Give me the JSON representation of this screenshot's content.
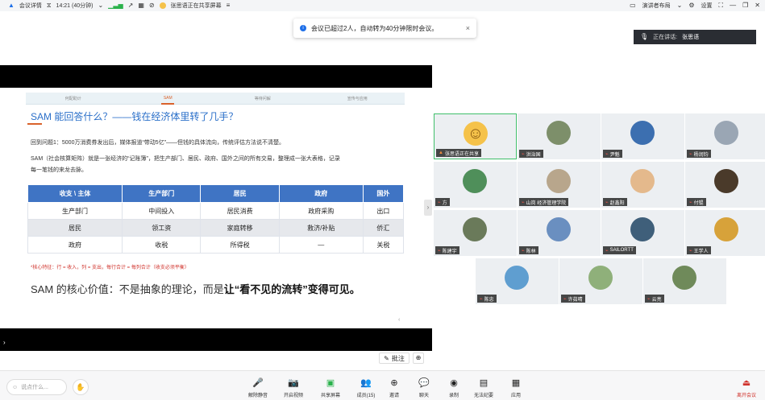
{
  "topbar": {
    "app_icon": "meeting-logo-icon",
    "meeting_details": "会议详情",
    "timer": "14:21 (40分钟)",
    "sharing_status": "张思语正在共享屏幕",
    "presenter_layout": "演讲者布局",
    "settings": "设置"
  },
  "toast": {
    "message": "会议已超过2人，自动转为40分钟限时会议。",
    "close": "×"
  },
  "speaking": {
    "label": "正在讲话:",
    "name": "张思语"
  },
  "slide": {
    "nav": [
      "何配助计",
      "SAM",
      "等待问解",
      "宣传与应用"
    ],
    "title": "SAM 能回答什么？——钱在经济体里转了几手？",
    "para1": "回到问题1：5000万消费券发出后，媒体报道“带动5亿”——但钱的具体流向，传统评估方法说不清楚。",
    "para2a": "SAM（社会核算矩阵）就是一张经济的“记账簿”，把生产部门、居民、政府、国外之间的所有交易，整理成一张大表格，记录",
    "para2b": "每一笔钱的来龙去脉。",
    "table_headers": [
      "收支 \\ 主体",
      "生产部门",
      "居民",
      "政府",
      "国外"
    ],
    "table_rows": [
      [
        "生产部门",
        "中间投入",
        "居民消费",
        "政府采购",
        "出口"
      ],
      [
        "居民",
        "领工资",
        "家庭转移",
        "救济/补贴",
        "侨汇"
      ],
      [
        "政府",
        "收税",
        "所得税",
        "—",
        "关税"
      ]
    ],
    "note": "*核心特征：行 = 收入，列 = 支出，每行合计 = 每列合计（收支必须平衡）",
    "core_prefix": "SAM 的核心价值：不是抽象的理论，而是",
    "core_bold": "让“看不见的流转”变得可见。",
    "page_marker": "‹"
  },
  "share_controls": {
    "annotate": "批注"
  },
  "participants": [
    {
      "name": "张思语正在共享",
      "avatar_color": "#f5c24a",
      "active": true
    },
    {
      "name": "洪治国",
      "avatar_color": "#7d8f6a"
    },
    {
      "name": "尹魁",
      "avatar_color": "#3c6fb0"
    },
    {
      "name": "杨润钧",
      "avatar_color": "#9aa6b4"
    },
    {
      "name": "方",
      "avatar_color": "#4f8f5a"
    },
    {
      "name": "山岗 经济管理学院",
      "avatar_color": "#b8a68c"
    },
    {
      "name": "赵鑫阳",
      "avatar_color": "#e4b98c"
    },
    {
      "name": "付锟",
      "avatar_color": "#4a3a2a"
    },
    {
      "name": "陈建宇",
      "avatar_color": "#6a7a5a"
    },
    {
      "name": "陈林",
      "avatar_color": "#6a8fc0"
    },
    {
      "name": "SAILORTT",
      "avatar_color": "#3f5f7a"
    },
    {
      "name": "王学人",
      "avatar_color": "#d7a23a"
    },
    {
      "name": "陈忠",
      "avatar_color": "#5f9ed0"
    },
    {
      "name": "许茹晴",
      "avatar_color": "#8fb07a"
    },
    {
      "name": "云亮",
      "avatar_color": "#6f8a5a"
    }
  ],
  "toolbar": {
    "chat_placeholder": "说点什么...",
    "tools": [
      {
        "label": "解除静音",
        "icon": "mic-off-icon"
      },
      {
        "label": "开启视频",
        "icon": "camera-off-icon"
      },
      {
        "label": "共享屏幕",
        "icon": "share-screen-icon"
      },
      {
        "label": "成员(15)",
        "icon": "members-icon"
      },
      {
        "label": "邀请",
        "icon": "invite-icon"
      },
      {
        "label": "聊天",
        "icon": "chat-icon"
      },
      {
        "label": "录制",
        "icon": "record-icon"
      },
      {
        "label": "无法纪要",
        "icon": "minutes-icon"
      },
      {
        "label": "应用",
        "icon": "apps-icon"
      }
    ],
    "leave": "离开会议"
  },
  "colors": {
    "accent": "#2a6fc9",
    "table_header": "#3f74c4",
    "active_border": "#3fbf6a",
    "leave": "#d0332c"
  }
}
